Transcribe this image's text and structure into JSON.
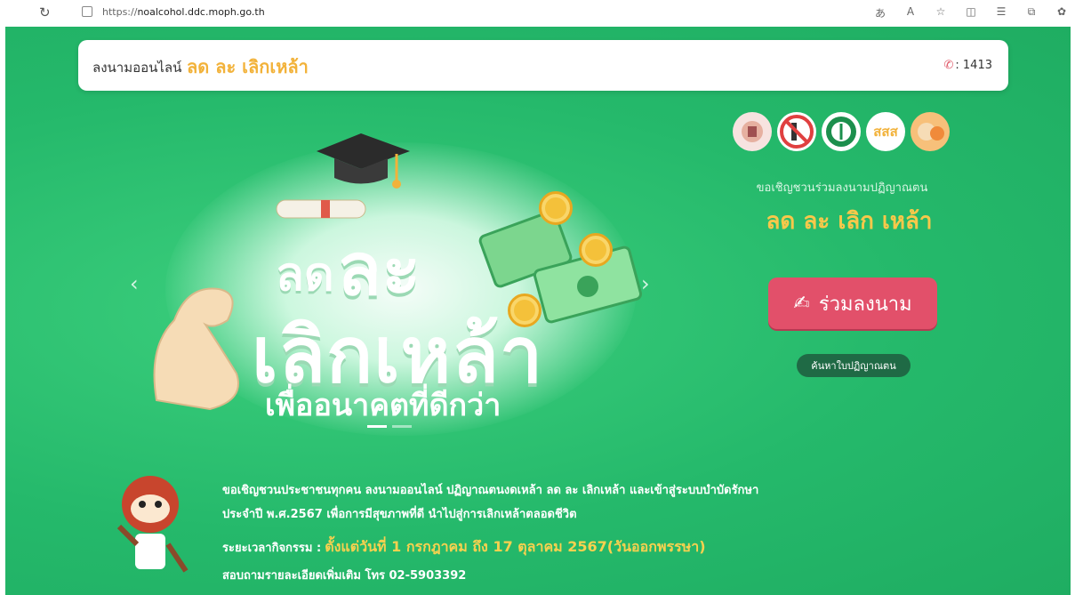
{
  "browser": {
    "url_prefix": "https://",
    "url_host": "noalcohol.ddc.moph.go.th",
    "toolbar_icons": [
      "translate-icon",
      "read-aloud-icon",
      "favorite-icon",
      "split-screen-icon",
      "favorites-list-icon",
      "collections-icon",
      "extension-icon"
    ]
  },
  "header": {
    "title": "ลงนามออนไลน์",
    "highlight": "ลด ละ เลิกเหล้า",
    "phone": ": 1413"
  },
  "hero": {
    "line1_small": "ลด",
    "line1_big": "ละ",
    "line2": "เลิกเหล้า",
    "subtitle": "เพื่ออนาคตที่ดีกว่า",
    "prev": "‹",
    "next": "›"
  },
  "side": {
    "logos": [
      "logo-1",
      "no-alcohol-logo",
      "moph-logo",
      "สสส",
      "mascot-logo"
    ],
    "logo_text_sss": "สสส",
    "invite": "ขอเชิญชวนร่วมลงนามปฏิญาณตน",
    "slogan": "ลด ละ เลิก เหล้า",
    "cta_label": "ร่วมลงนาม",
    "search_label": "ค้นหาใบปฏิญาณตน"
  },
  "info": {
    "para1": "ขอเชิญชวนประชาชนทุกคน ลงนามออนไลน์ ปฏิญาณตนงดเหล้า ลด ละ เลิกเหล้า และเข้าสู่ระบบบำบัดรักษา",
    "para2": "ประจำปี พ.ศ.2567 เพื่อการมีสุขภาพที่ดี นำไปสู่การเลิกเหล้าตลอดชีวิต",
    "period_label": "ระยะเวลากิจกรรม :",
    "period_value": "ตั้งแต่วันที่ 1 กรกฎาคม ถึง 17 ตุลาคม 2567(วันออกพรรษา)",
    "contact": "สอบถามรายละเอียดเพิ่มเติม โทร 02-5903392"
  },
  "colors": {
    "page_bg": "#23b868",
    "accent_yellow": "#f2b23a",
    "cta_red": "#e2506a",
    "dark_green": "#1f6a45"
  }
}
